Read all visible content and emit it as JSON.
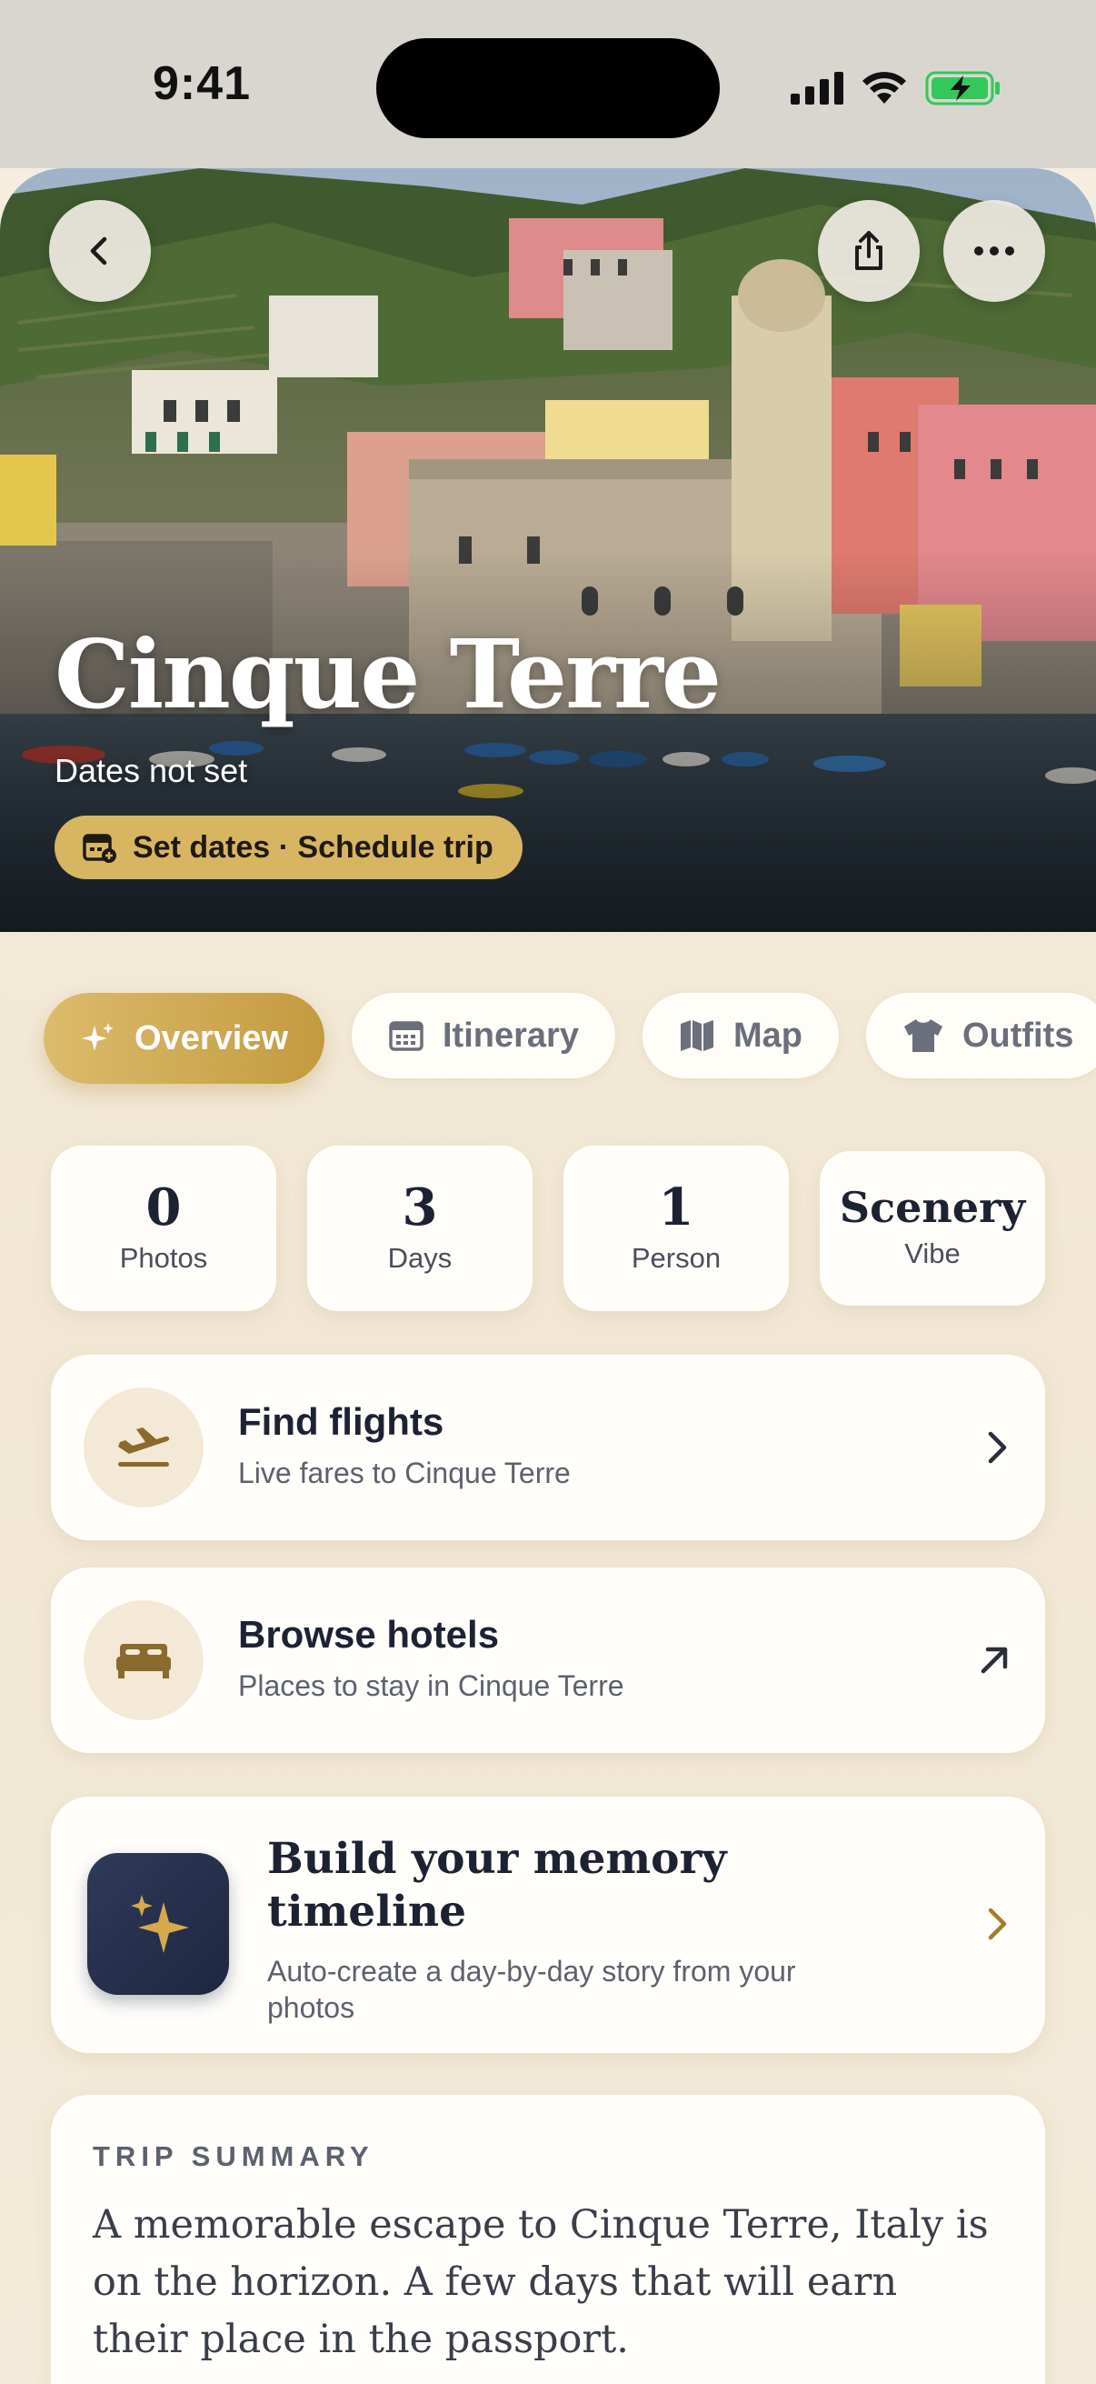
{
  "status_bar": {
    "time": "9:41"
  },
  "hero": {
    "title": "Cinque Terre",
    "dates": "Dates not set",
    "set_dates_label": "Set dates · Schedule trip"
  },
  "tabs": [
    {
      "label": "Overview",
      "icon": "sparkle-icon",
      "active": true
    },
    {
      "label": "Itinerary",
      "icon": "calendar-icon",
      "active": false
    },
    {
      "label": "Map",
      "icon": "map-icon",
      "active": false
    },
    {
      "label": "Outfits",
      "icon": "shirt-icon",
      "active": false
    }
  ],
  "stats": [
    {
      "value": "0",
      "label": "Photos"
    },
    {
      "value": "3",
      "label": "Days"
    },
    {
      "value": "1",
      "label": "Person"
    },
    {
      "value": "Scenery",
      "label": "Vibe"
    }
  ],
  "actions": {
    "flights": {
      "title": "Find flights",
      "subtitle": "Live fares to Cinque Terre"
    },
    "hotels": {
      "title": "Browse hotels",
      "subtitle": "Places to stay in Cinque Terre"
    },
    "memory": {
      "title": "Build your memory timeline",
      "subtitle": "Auto-create a day-by-day story from your photos"
    }
  },
  "summary": {
    "label": "TRIP SUMMARY",
    "text": "A memorable escape to Cinque Terre, Italy is on the horizon. A few days that will earn their place in the passport."
  },
  "colors": {
    "accent_gold": "#c9a14a",
    "background_cream": "#f3ebdb",
    "text_dark": "#1d2233",
    "battery_green": "#34c759"
  }
}
